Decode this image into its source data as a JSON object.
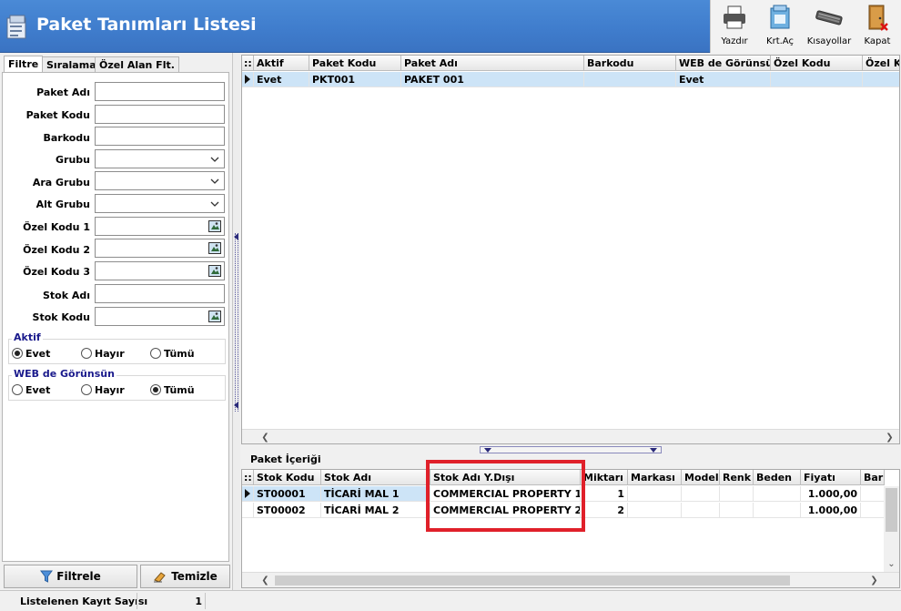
{
  "window": {
    "title": "Paket Tanımları Listesi"
  },
  "toolbar": {
    "items": [
      {
        "label": "Yazdır",
        "icon": "printer-icon"
      },
      {
        "label": "Krt.Aç",
        "icon": "open-card-icon"
      },
      {
        "label": "Kısayollar",
        "icon": "keyboard-icon"
      },
      {
        "label": "Kapat",
        "icon": "close-door-icon"
      }
    ]
  },
  "left": {
    "tabs": [
      "Filtre",
      "Sıralama",
      "Özel Alan Flt."
    ],
    "fields": [
      "Paket Adı",
      "Paket Kodu",
      "Barkodu",
      "Grubu",
      "Ara Grubu",
      "Alt Grubu",
      "Özel Kodu 1",
      "Özel Kodu 2",
      "Özel Kodu 3",
      "Stok Adı",
      "Stok Kodu"
    ],
    "aktif": {
      "title": "Aktif",
      "options": [
        "Evet",
        "Hayır",
        "Tümü"
      ],
      "selected": "Evet"
    },
    "web": {
      "title": "WEB de Görünsün",
      "options": [
        "Evet",
        "Hayır",
        "Tümü"
      ],
      "selected": "Tümü"
    },
    "filter_button": "Filtrele",
    "clear_button": "Temizle"
  },
  "main_grid": {
    "headers": [
      "Aktif",
      "Paket Kodu",
      "Paket Adı",
      "Barkodu",
      "WEB de Görünsün",
      "Özel Kodu",
      "Özel K"
    ],
    "rows": [
      [
        "Evet",
        "PKT001",
        "PAKET 001",
        "",
        "Evet",
        "",
        ""
      ]
    ]
  },
  "detail": {
    "title": "Paket İçeriği",
    "headers": [
      "Stok Kodu",
      "Stok Adı",
      "Stok Adı Y.Dışı",
      "Miktarı",
      "Markası",
      "Modeli",
      "Renk",
      "Beden",
      "Fiyatı",
      "Bar"
    ],
    "rows": [
      [
        "ST00001",
        "TİCARİ MAL 1",
        "COMMERCIAL PROPERTY 1",
        "1",
        "",
        "",
        "",
        "",
        "1.000,00",
        ""
      ],
      [
        "ST00002",
        "TİCARİ MAL 2",
        "COMMERCIAL PROPERTY 2",
        "2",
        "",
        "",
        "",
        "",
        "1.000,00",
        ""
      ]
    ]
  },
  "status": {
    "label": "Listelenen Kayıt Sayısı",
    "count": "1"
  },
  "colors": {
    "header": "#3f7ccc",
    "selection": "#cde4f7",
    "highlight": "#e0202a"
  }
}
